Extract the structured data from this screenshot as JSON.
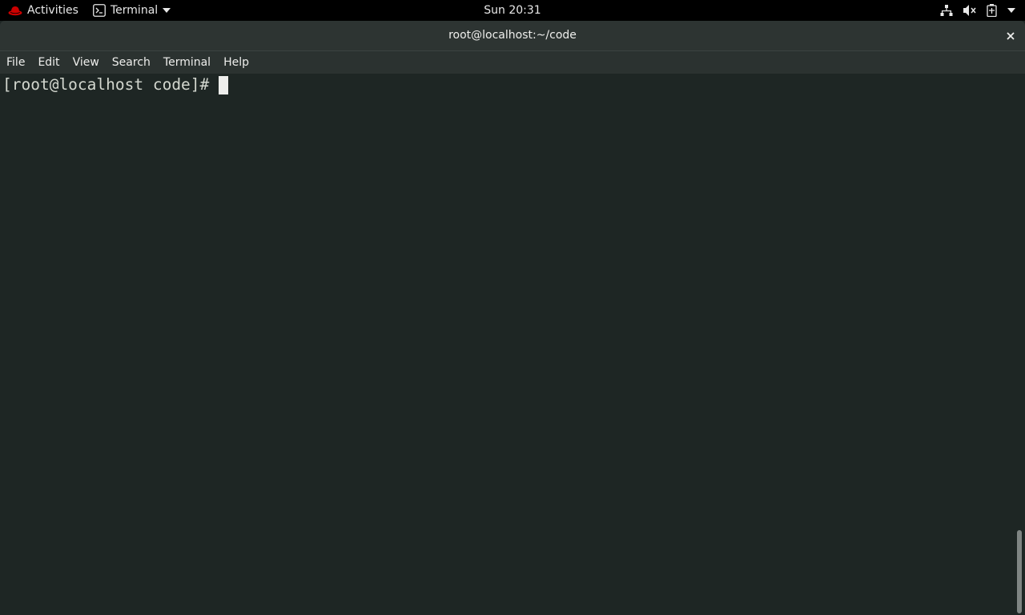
{
  "topbar": {
    "activities_label": "Activities",
    "app_menu_label": "Terminal",
    "clock": "Sun 20:31",
    "icons": [
      "redhat-logo-icon",
      "terminal-app-icon",
      "chevron-down-icon",
      "network-icon",
      "volume-muted-icon",
      "battery-icon",
      "chevron-down-icon"
    ]
  },
  "window": {
    "title": "root@localhost:~/code"
  },
  "menubar": {
    "items": [
      {
        "label": "File"
      },
      {
        "label": "Edit"
      },
      {
        "label": "View"
      },
      {
        "label": "Search"
      },
      {
        "label": "Terminal"
      },
      {
        "label": "Help"
      }
    ]
  },
  "terminal": {
    "prompt": "[root@localhost code]#",
    "background": "#1e2624",
    "foreground": "#d3d7cf"
  },
  "colors": {
    "topbar": "#000000",
    "titlebar": "#2d3432",
    "accent_logo": "#cc0000"
  }
}
